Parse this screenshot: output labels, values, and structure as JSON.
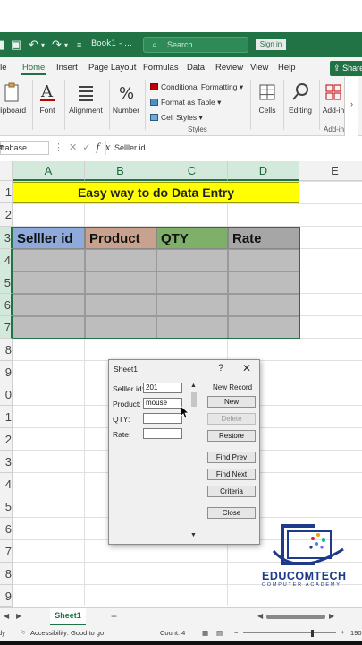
{
  "titlebar": {
    "doc_name": "Book1 - ...",
    "search_placeholder": "Search",
    "signin": "Sign in"
  },
  "ribbon_tabs": [
    "ile",
    "Home",
    "Insert",
    "Page Layout",
    "Formulas",
    "Data",
    "Review",
    "View",
    "Help"
  ],
  "share_label": "Share",
  "ribbon": {
    "clipboard": "lipboard",
    "font": "Font",
    "alignment": "Alignment",
    "number": "Number",
    "conditional_formatting": "Conditional Formatting",
    "format_as_table": "Format as Table",
    "cell_styles": "Cell Styles",
    "styles_group": "Styles",
    "cells": "Cells",
    "editing": "Editing",
    "addin": "Add-in",
    "addin_group": "Add-in"
  },
  "formula_bar": {
    "name_box": "atabase",
    "value": "Selller id"
  },
  "columns": [
    "A",
    "B",
    "C",
    "D",
    "E"
  ],
  "rows": [
    "1",
    "2",
    "3",
    "4",
    "5",
    "6",
    "7",
    "8",
    "9",
    "0",
    "1",
    "2",
    "3",
    "4",
    "5",
    "6",
    "7",
    "8",
    "9"
  ],
  "sheet": {
    "title": "Easy way to do Data Entry",
    "headers": [
      "Selller id",
      "Product",
      "QTY",
      "Rate"
    ],
    "header_colors": [
      "#8eaadb",
      "#c9a28f",
      "#7fb069",
      "#a6a6a6"
    ]
  },
  "dialog": {
    "title": "Sheet1",
    "help": "?",
    "close": "✕",
    "fields": [
      {
        "label": "Selller id:",
        "value": "201"
      },
      {
        "label": "Product:",
        "value": "mouse"
      },
      {
        "label": "QTY:",
        "value": ""
      },
      {
        "label": "Rate:",
        "value": ""
      }
    ],
    "record_status": "New Record",
    "buttons": [
      "New",
      "Delete",
      "Restore",
      "Find Prev",
      "Find Next",
      "Criteria",
      "Close"
    ]
  },
  "logo": {
    "name": "EDUCOMTECH",
    "tagline": "COMPUTER ACADEMY"
  },
  "sheet_tab": "Sheet1",
  "status": {
    "ready": "dy",
    "accessibility": "Accessibility: Good to go",
    "count": "Count: 4",
    "zoom": "190"
  }
}
